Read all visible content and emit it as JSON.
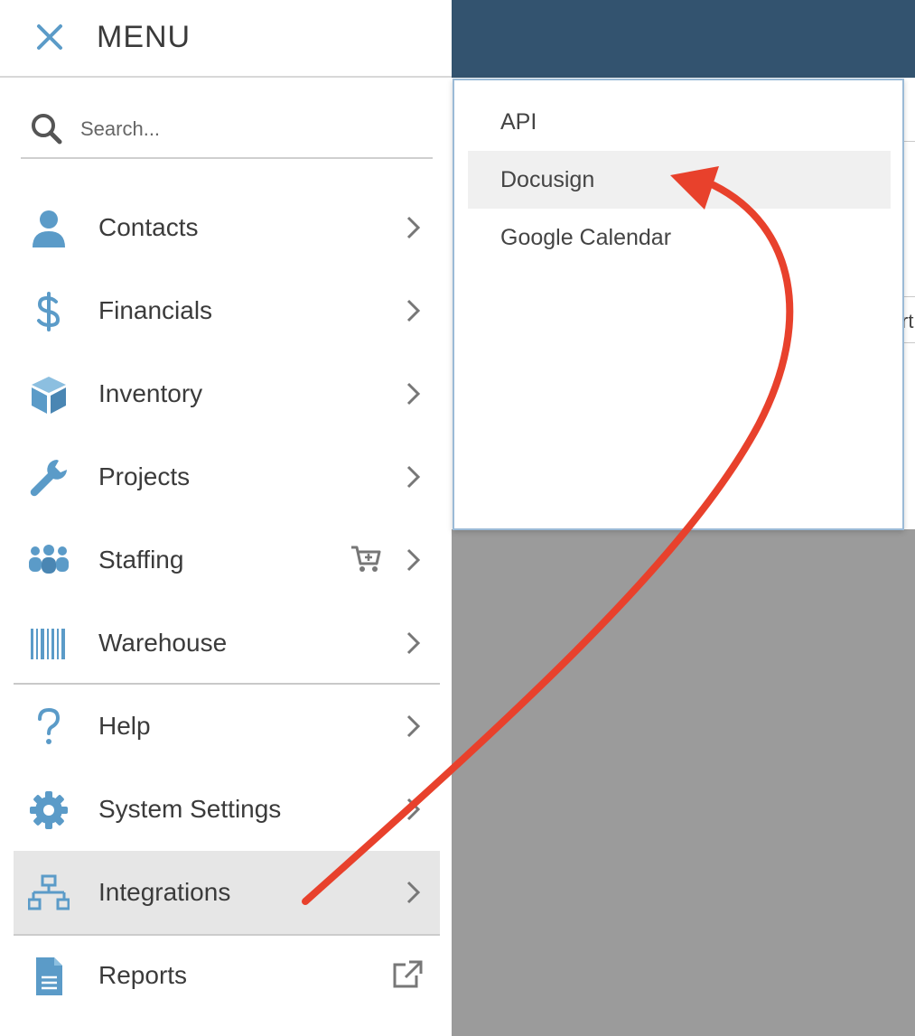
{
  "menu": {
    "title": "MENU",
    "close_icon": "close-icon",
    "search_placeholder": "Search...",
    "accent_color": "#5b9bc8"
  },
  "items": [
    {
      "label": "Contacts",
      "icon": "person-icon"
    },
    {
      "label": "Financials",
      "icon": "dollar-icon"
    },
    {
      "label": "Inventory",
      "icon": "box-icon"
    },
    {
      "label": "Projects",
      "icon": "wrench-icon"
    },
    {
      "label": "Staffing",
      "icon": "group-icon",
      "extra_icon": "cart-plus-icon"
    },
    {
      "label": "Warehouse",
      "icon": "barcode-icon"
    },
    {
      "label": "Help",
      "icon": "question-icon"
    },
    {
      "label": "System Settings",
      "icon": "gear-icon"
    },
    {
      "label": "Integrations",
      "icon": "network-icon",
      "active": true
    },
    {
      "label": "Reports",
      "icon": "document-icon",
      "trailing_icon": "external-link-icon"
    }
  ],
  "submenu": {
    "items": [
      {
        "label": "API"
      },
      {
        "label": "Docusign",
        "highlighted": true
      },
      {
        "label": "Google Calendar"
      }
    ]
  },
  "annotation": {
    "color": "#e8412c"
  },
  "background": {
    "topbar_color": "#33536f",
    "text_fragment": "rt"
  }
}
